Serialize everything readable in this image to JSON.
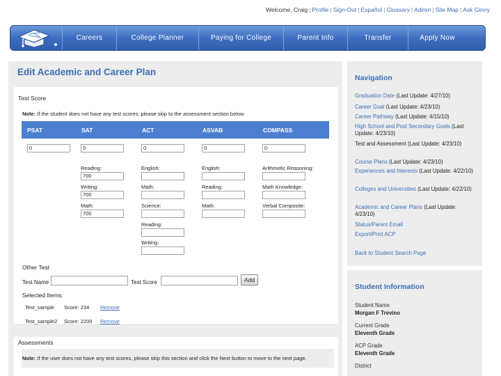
{
  "header": {
    "welcome": "Welcome, Craig",
    "links": [
      "Profile",
      "Sign-Out",
      "Español",
      "Glossary",
      "Admin",
      "Site Map",
      "Ask Ginny"
    ]
  },
  "nav": {
    "items": [
      "Careers",
      "College Planner",
      "Paying for College",
      "Parent Info",
      "Transfer",
      "Apply Now"
    ]
  },
  "page": {
    "title": "Edit Academic and Career Plan"
  },
  "test_score": {
    "title": "Test Score",
    "note_bold": "Note:",
    "note_text": " If the student does not have any test scores, please skip to the assessment section below",
    "columns": [
      "PSAT",
      "SAT",
      "ACT",
      "ASVAB",
      "COMPASS"
    ],
    "main_values": [
      "0",
      "0",
      "0",
      "0",
      "0"
    ],
    "sat": {
      "labels": [
        "Reading:",
        "Writing:",
        "Math:"
      ],
      "values": [
        "700",
        "700",
        "700"
      ]
    },
    "act": {
      "labels": [
        "English:",
        "Math:",
        "Science:",
        "Reading:",
        "Writing:"
      ]
    },
    "asvab": {
      "labels": [
        "English:",
        "Reading:",
        "Math:"
      ]
    },
    "compass": {
      "labels": [
        "Arithmetic Reasoning:",
        "Math Knowledge:",
        "Verbal Composite:"
      ]
    }
  },
  "other_test": {
    "title": "Other Test",
    "name_label": "Test Name",
    "score_label": "Test Score",
    "add_label": "Add",
    "selected_title": "Selected Items:",
    "items": [
      {
        "name": "Test_sample",
        "score": "Score: 234",
        "remove": "Remove"
      },
      {
        "name": "Test_sample2",
        "score": "Score: 2200",
        "remove": "Remove"
      }
    ]
  },
  "assessments": {
    "title": "Assessments",
    "note_bold": "Note:",
    "note_text": " If the user does not have any test scores, please skip this section and click the Next button to move to the next page."
  },
  "sidebar_nav": {
    "title": "Navigation",
    "items": [
      {
        "label": "Graduation Date",
        "meta": " (Last Update: 4/27/10)"
      },
      {
        "label": "Career Goal",
        "meta": " (Last Update: 4/23/10)"
      },
      {
        "label": "Career Pathway",
        "meta": " (Last Update: 4/15/10)"
      },
      {
        "label": "High School and Post Secondary Goals",
        "meta": " (Last Update: 4/23/10)"
      },
      {
        "label": "Test and Assessment",
        "meta": " (Last Update: 4/23/10)"
      },
      {
        "label": "Course Plans",
        "meta": " (Last Update: 4/23/10)"
      },
      {
        "label": "Experiences and Interests",
        "meta": " (Last Update: 4/22/10)"
      },
      {
        "label": "Colleges and Universities",
        "meta": " (Last Update: 4/22/10)"
      },
      {
        "label": "Academic and Career Plans",
        "meta": " (Last Update: 4/23/10)"
      },
      {
        "label": "Status/Parent Email",
        "meta": ""
      },
      {
        "label": "Export/Print ACP",
        "meta": ""
      }
    ],
    "back": "Back to Student Search Page"
  },
  "student_info": {
    "title": "Student Information",
    "fields": [
      {
        "label": "Student Name",
        "value": "Morgan F Trevino"
      },
      {
        "label": "Current Grade",
        "value": "Eleventh Grade"
      },
      {
        "label": "ACP Grade",
        "value": "Eleventh Grade"
      },
      {
        "label": "District",
        "value": ""
      }
    ]
  }
}
